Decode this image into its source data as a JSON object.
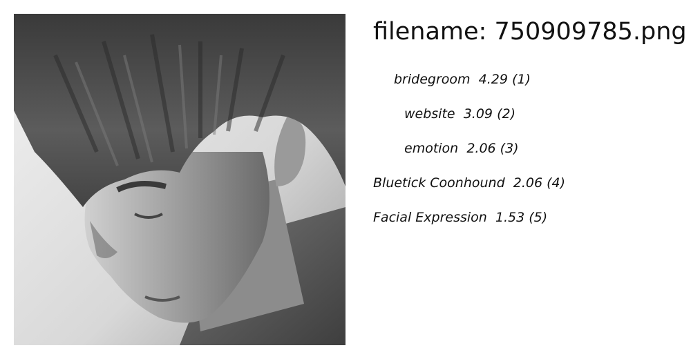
{
  "header": {
    "filename_text": "filename: 750909785.png"
  },
  "photo": {
    "description_icon": "grayscale-face-photo"
  },
  "predictions": [
    {
      "label": "bridegroom",
      "score": "4.29",
      "rank": "(1)"
    },
    {
      "label": "website",
      "score": "3.09",
      "rank": "(2)"
    },
    {
      "label": "emotion",
      "score": "2.06",
      "rank": "(3)"
    },
    {
      "label": "Bluetick Coonhound",
      "score": "2.06",
      "rank": "(4)"
    },
    {
      "label": "Facial Expression",
      "score": "1.53",
      "rank": "(5)"
    }
  ]
}
